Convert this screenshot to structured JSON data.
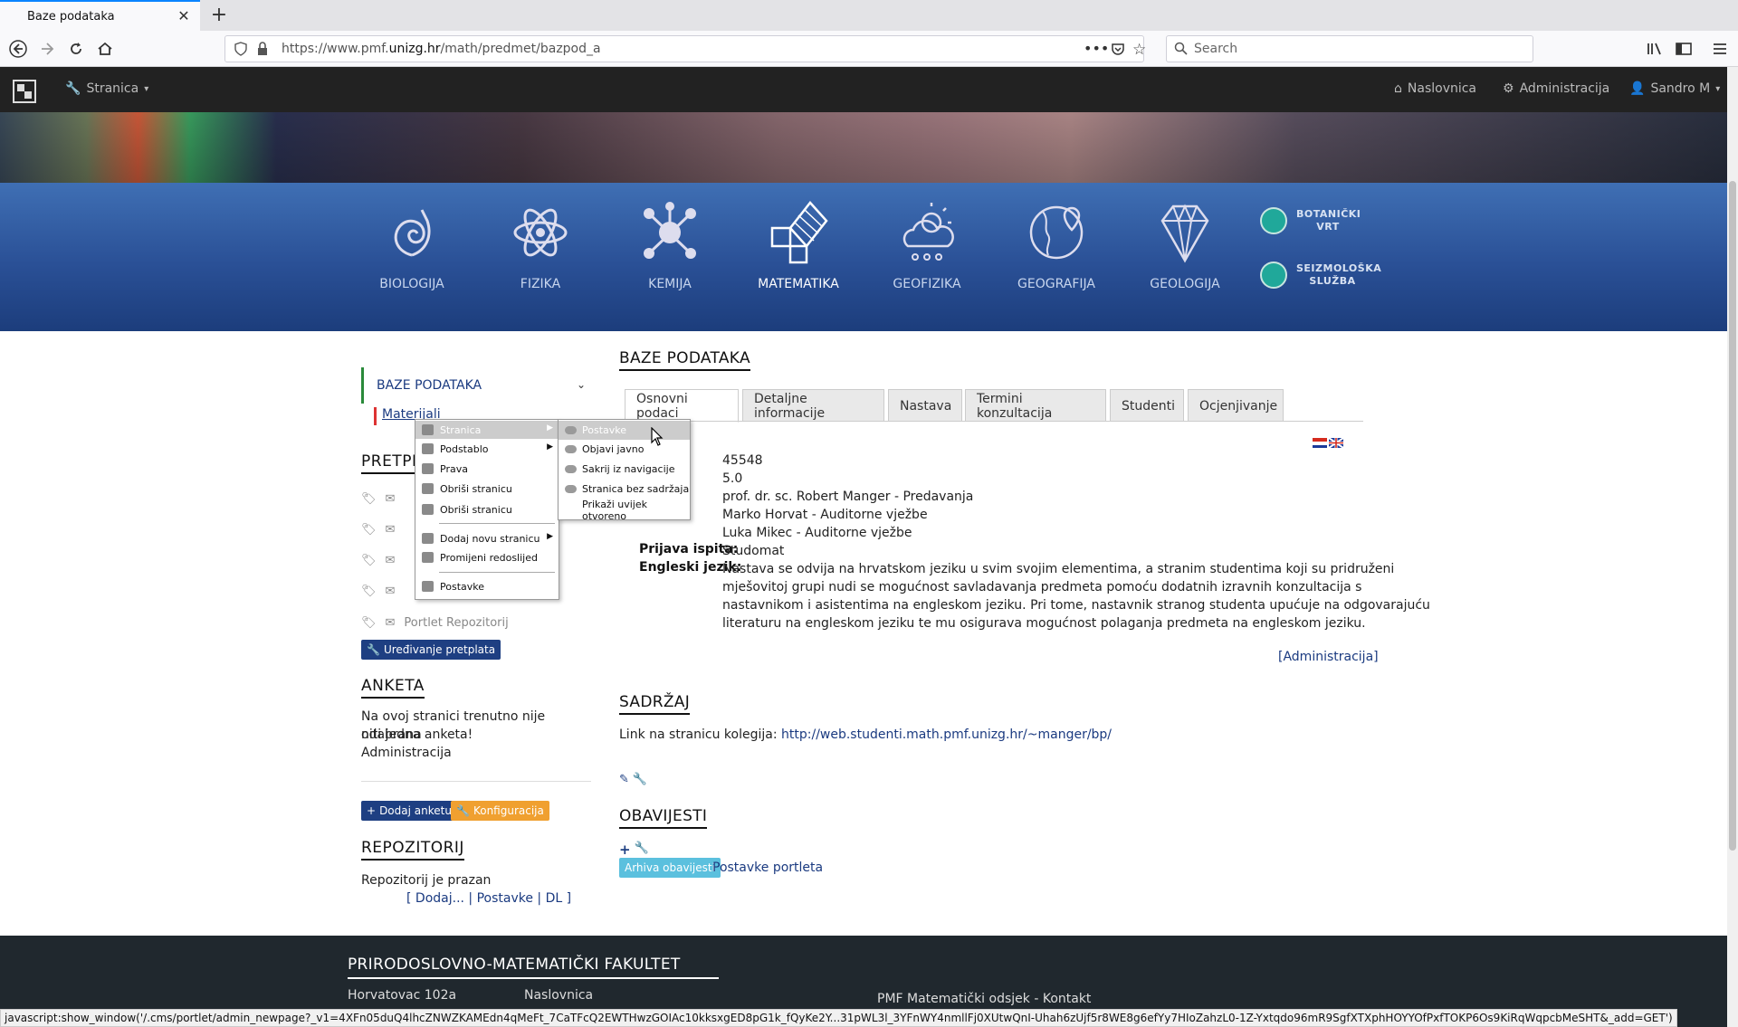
{
  "browser": {
    "tab_title": "Baze podataka",
    "url_prefix": "https://www.pmf.",
    "url_domain": "unizg.hr",
    "url_path": "/math/predmet/bazpod_a",
    "search_placeholder": "Search",
    "status_text": "javascript:show_window('/.cms/portlet/admin_newpage?_v1=4XFn05duQ4lhcZNWZKAMEdn4qMeFt_7CaTFcQ2EWTHwzGOIAc10kksxgED8pG1k_fQyKe2Y...31pWL3l_3YFnWY4nmllFj0XUtwQnI-Uhah6zUjf5r8WE8g6efYy7HIoZahzL0-1Z-Yxtqdo96mR9SgfXTXphHOYYOfPxfTOKP6Os9KiRqWqpcbMeSHT&_add=GET')"
  },
  "adminbar": {
    "page_menu": "Stranica",
    "home": "Naslovnica",
    "admin": "Administracija",
    "user": "Sandro M"
  },
  "departments": [
    {
      "label": "BIOLOGIJA",
      "icon": "shell-icon"
    },
    {
      "label": "FIZIKA",
      "icon": "atom-icon"
    },
    {
      "label": "KEMIJA",
      "icon": "molecule-icon"
    },
    {
      "label": "MATEMATIKA",
      "icon": "pythagoras-icon"
    },
    {
      "label": "GEOFIZIKA",
      "icon": "cloud-sun-icon"
    },
    {
      "label": "GEOGRAFIJA",
      "icon": "globe-pin-icon"
    },
    {
      "label": "GEOLOGIJA",
      "icon": "diamond-icon"
    }
  ],
  "side_links": {
    "botanical": "BOTANIČKI VRT",
    "seismology": "SEIZMOLOŠKA SLUŽBA"
  },
  "left": {
    "menu_head": "BAZE PODATAKA",
    "sub_item": "Materijali",
    "subscriptions_title": "PRETPLATE",
    "subscription_last": "Portlet Repozitorij",
    "edit_subscriptions": "Uređivanje pretplata",
    "poll_title": "ANKETA",
    "poll_text_1": "Na ovoj stranici trenutno nije odabrana",
    "poll_text_2": "niti jedna anketa!",
    "poll_admin": "Administracija",
    "add_poll": "Dodaj anketu",
    "config": "Konfiguracija",
    "repo_title": "REPOZITORIJ",
    "repo_empty": "Repozitorij je prazan",
    "repo_links": "[ Dodaj... | Postavke | DL ]"
  },
  "context_menu": {
    "items": [
      "Stranica",
      "Podstablo",
      "Prava",
      "Obriši stranicu",
      "Obriši stranicu",
      "Dodaj novu stranicu",
      "Promijeni redoslijed",
      "Postavke"
    ],
    "submenu": [
      "Postavke",
      "Objavi javno",
      "Sakrij iz navigacije",
      "Stranica bez sadržaja",
      "Prikaži uvijek otvoreno"
    ]
  },
  "main": {
    "title": "BAZE PODATAKA",
    "tabs": [
      "Osnovni podaci",
      "Detaljne informacije",
      "Nastava",
      "Termini konzultacija",
      "Studenti",
      "Ocjenjivanje"
    ],
    "code": "45548",
    "ects": "5.0",
    "lecturer_1": "prof. dr. sc. Robert Manger - Predavanja",
    "lecturer_2": "Marko Horvat - Auditorne vježbe",
    "lecturer_3": "Luka Mikec - Auditorne vježbe",
    "exam_label": "Prijava ispita:",
    "exam_value": "Studomat",
    "english_label": "Engleski jezik:",
    "english_1": "Nastava se odvija na hrvatskom jeziku u svim svojim elementima, a stranim studentima koji su pridruženi",
    "english_2": "mješovitoj grupi nudi se mogućnost savladavanja predmeta pomoću dodatnih izravnih konzultacija s",
    "english_3": "nastavnikom i asistentima na engleskom jeziku. Pri tome, nastavnik stranog studenta upućuje na odgovarajuću",
    "english_4": "literaturu na engleskom jeziku te mu osigurava mogućnost polaganja predmeta na engleskom jeziku.",
    "admin_link": "[Administracija]",
    "content_title": "SADRŽAJ",
    "content_prefix": "Link na stranicu kolegija:",
    "content_link": "http://web.studenti.math.pmf.unizg.hr/~manger/bp/",
    "news_title": "OBAVIJESTI",
    "news_archive": "Arhiva obavijesti",
    "news_settings": "Postavke portleta"
  },
  "footer": {
    "title": "PRIRODOSLOVNO-MATEMATIČKI FAKULTET",
    "address": "Horvatovac 102a",
    "home": "Naslovnica",
    "contact": "PMF Matematički odsjek - Kontakt"
  },
  "colors": {
    "banner": "#2a5096",
    "primary_button": "#1e3f82",
    "accent_button": "#f0a030",
    "archive_button": "#5bc0de"
  }
}
